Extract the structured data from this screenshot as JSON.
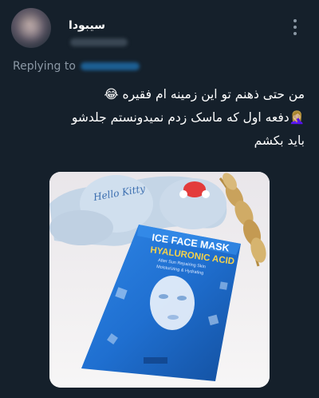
{
  "author": {
    "display_name": "سیبودا",
    "avatar_icon": "avatar-icon",
    "more_icon": "more-options-icon"
  },
  "reply": {
    "label": "Replying to"
  },
  "tweet": {
    "lines": [
      "من حتی ذهنم تو این زمینه ام فقیره 😂",
      "🤦🏼‍♀️دفعه اول که ماسک زدم  نمیدونستم جلدشو",
      "باید بکشم"
    ]
  },
  "photo": {
    "mask_title": "ICE FACE MASK",
    "mask_subtitle": "HYALURONIC ACID",
    "mask_small_line1": "After Sun Repairing Skin",
    "mask_small_line2": "Moisturizing & Hydrating",
    "towel_text": "Hello Kitty",
    "colors": {
      "mask_blue": "#1f6fd0",
      "towel": "#c4d5e6",
      "wheat": "#c9a25c"
    }
  }
}
